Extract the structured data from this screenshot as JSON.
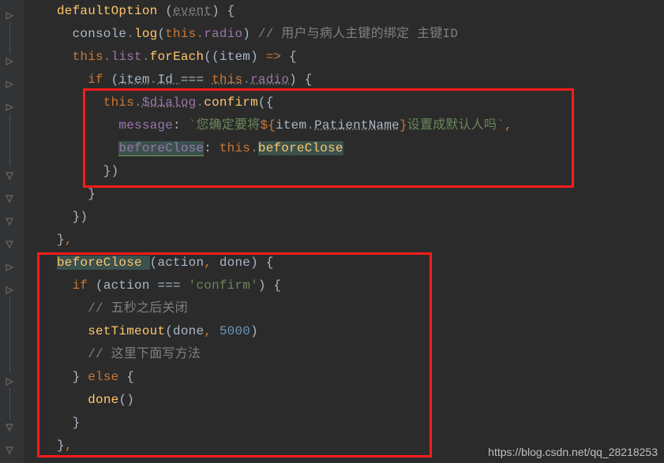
{
  "code": {
    "l1_a": "defaultOption ",
    "l1_b": "(",
    "l1_c": "event",
    "l1_d": ") ",
    "l1_e": "{",
    "l2_a": "  console",
    "l2_b": ".",
    "l2_c": "log",
    "l2_d": "(",
    "l2_e": "this",
    "l2_f": ".",
    "l2_g": "radio",
    "l2_h": ") ",
    "l2_i": "// 用户与病人主键的绑定 主键ID",
    "l3_a": "  ",
    "l3_b": "this",
    "l3_c": ".",
    "l3_d": "list",
    "l3_e": ".",
    "l3_f": "forEach",
    "l3_g": "((",
    "l3_h": "item",
    "l3_i": ") ",
    "l3_j": "=>",
    "l3_k": " {",
    "l4_a": "    ",
    "l4_b": "if ",
    "l4_c": "(",
    "l4_d": "item",
    "l4_e": ".",
    "l4_f": "Id ",
    "l4_g": "=== ",
    "l4_h": "this",
    "l4_i": ".",
    "l4_j": "radio",
    "l4_k": ") ",
    "l4_l": "{",
    "l5_a": "      ",
    "l5_b": "this",
    "l5_c": ".",
    "l5_d": "$dialog",
    "l5_e": ".",
    "l5_f": "confirm",
    "l5_g": "({",
    "l6_a": "        ",
    "l6_b": "message",
    "l6_c": ": ",
    "l6_d": "`您确定要将",
    "l6_e": "${",
    "l6_f": "item",
    "l6_g": ".",
    "l6_h": "PatientName",
    "l6_i": "}",
    "l6_j": "设置成默认人吗`",
    "l6_k": ",",
    "l7_a": "        ",
    "l7_b": "beforeClose",
    "l7_c": ": ",
    "l7_d": "this",
    "l7_e": ".",
    "l7_f": "beforeClose",
    "l8_a": "      })",
    "l9_a": "    }",
    "l10_a": "  })",
    "l11_a": "}",
    "l11_b": ",",
    "l12_a": "beforeClose ",
    "l12_b": "(",
    "l12_c": "action",
    "l12_d": ", ",
    "l12_e": "done",
    "l12_f": ") ",
    "l12_g": "{",
    "l13_a": "  ",
    "l13_b": "if ",
    "l13_c": "(",
    "l13_d": "action ",
    "l13_e": "=== ",
    "l13_f": "'confirm'",
    "l13_g": ") ",
    "l13_h": "{",
    "l14_a": "    ",
    "l14_b": "// 五秒之后关闭",
    "l15_a": "    ",
    "l15_b": "setTimeout",
    "l15_c": "(",
    "l15_d": "done",
    "l15_e": ", ",
    "l15_f": "5000",
    "l15_g": ")",
    "l16_a": "    ",
    "l16_b": "// 这里下面写方法",
    "l17_a": "  } ",
    "l17_b": "else ",
    "l17_c": "{",
    "l18_a": "    ",
    "l18_b": "done",
    "l18_c": "()",
    "l19_a": "  }",
    "l20_a": "}",
    "l20_b": ","
  },
  "watermark": "https://blog.csdn.net/qq_28218253"
}
